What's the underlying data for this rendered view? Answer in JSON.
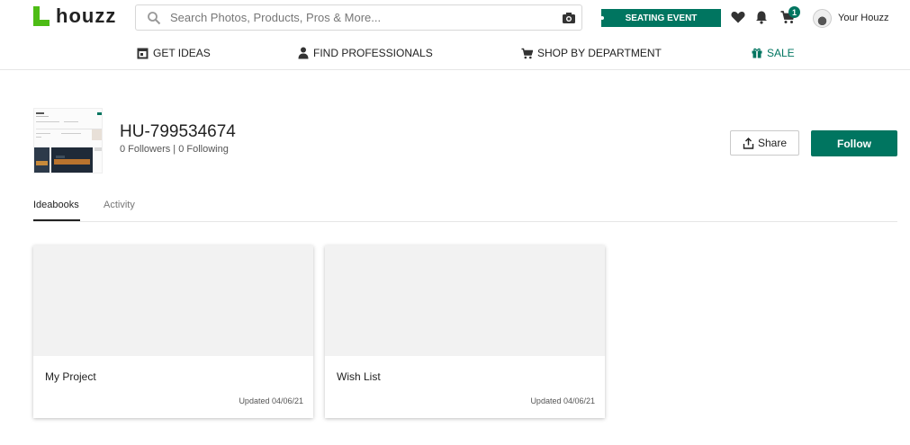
{
  "brand": {
    "name": "houzz",
    "accent": "#4dbc15",
    "green": "#007560"
  },
  "header": {
    "search_placeholder": "Search Photos, Products, Pros & More...",
    "event_label": "SEATING EVENT",
    "cart_count": "1",
    "account_label": "Your Houzz",
    "icons": [
      "search-icon",
      "camera-icon",
      "heart-icon",
      "bell-icon",
      "cart-icon"
    ]
  },
  "nav": {
    "items": [
      {
        "label": "GET IDEAS",
        "icon": "ideas-icon"
      },
      {
        "label": "FIND PROFESSIONALS",
        "icon": "professional-icon"
      },
      {
        "label": "SHOP BY DEPARTMENT",
        "icon": "shopping-cart-icon"
      },
      {
        "label": "SALE",
        "icon": "gift-icon"
      }
    ]
  },
  "profile": {
    "name": "HU-799534674",
    "stats": "0 Followers | 0 Following",
    "share_label": "Share",
    "follow_label": "Follow"
  },
  "tabs": [
    {
      "label": "Ideabooks",
      "active": true
    },
    {
      "label": "Activity",
      "active": false
    }
  ],
  "ideabooks": [
    {
      "title": "My Project",
      "updated": "Updated 04/06/21"
    },
    {
      "title": "Wish List",
      "updated": "Updated 04/06/21"
    }
  ]
}
